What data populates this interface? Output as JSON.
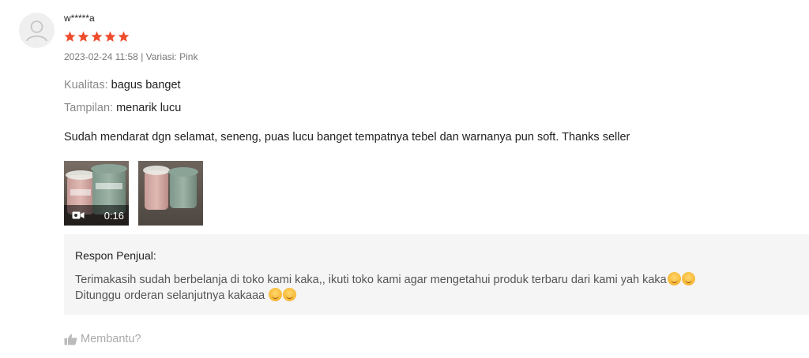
{
  "review": {
    "username": "w*****a",
    "rating": 5,
    "meta": "2023-02-24 11:58 | Variasi: Pink",
    "attributes": [
      {
        "key": "Kualitas:",
        "value": "bagus banget"
      },
      {
        "key": "Tampilan:",
        "value": "menarik lucu"
      }
    ],
    "comment": "Sudah mendarat dgn selamat, seneng, puas lucu banget tempatnya tebel dan warnanya pun soft. Thanks seller",
    "media": {
      "video_duration": "0:16",
      "photo_count": 2
    },
    "icons": {
      "avatar": "default-user-avatar",
      "star": "star-icon",
      "video": "video-camera-icon",
      "helpful": "thumbs-up-icon"
    },
    "colors": {
      "star": "#ee4d2d",
      "seller_bg": "#f5f5f5"
    }
  },
  "seller_response": {
    "title": "Respon Penjual:",
    "line1": "Terimakasih sudah berbelanja di toko kami kaka,, ikuti toko kami agar mengetahui produk terbaru dari kami yah kaka",
    "line2": "Ditunggu orderan selanjutnya kakaaa"
  },
  "helpful_label": "Membantu?"
}
